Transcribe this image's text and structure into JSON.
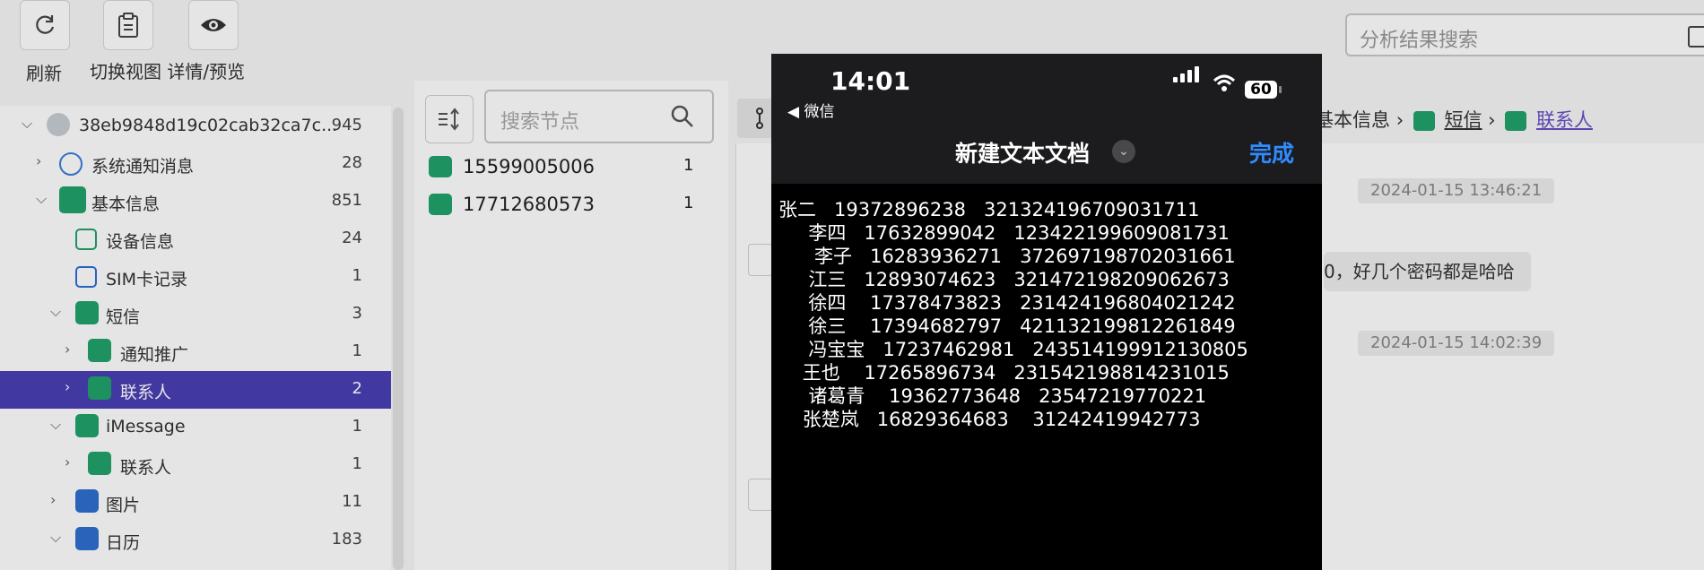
{
  "toolbar": {
    "refresh_label": "刷新",
    "switch_view_label": "切换视图 详情/预览",
    "search_placeholder": "分析结果搜索"
  },
  "tree": [
    {
      "label": "38eb9848d19c02cab32ca7c...",
      "count": "945"
    },
    {
      "label": "系统通知消息",
      "count": "28"
    },
    {
      "label": "基本信息",
      "count": "851"
    },
    {
      "label": "设备信息",
      "count": "24"
    },
    {
      "label": "SIM卡记录",
      "count": "1"
    },
    {
      "label": "短信",
      "count": "3"
    },
    {
      "label": "通知推广",
      "count": "1"
    },
    {
      "label": "联系人",
      "count": "2"
    },
    {
      "label": "iMessage",
      "count": "1"
    },
    {
      "label": "联系人",
      "count": "1"
    },
    {
      "label": "图片",
      "count": "11"
    },
    {
      "label": "日历",
      "count": "183"
    }
  ],
  "node_search": {
    "placeholder": "搜索节点"
  },
  "list": [
    {
      "label": "15599005006",
      "count": "1"
    },
    {
      "label": "17712680573",
      "count": "1"
    }
  ],
  "breadcrumb": {
    "part1": "基本信息",
    "part2": "短信",
    "part3": "联系人",
    "sep": "›"
  },
  "messages": {
    "date1": "2024-01-15 13:46:21",
    "bubble": "0，好几个密码都是哈哈",
    "date2": "2024-01-15 14:02:39"
  },
  "phone": {
    "time": "14:01",
    "back_label": "◀ 微信",
    "battery": "60",
    "title": "新建文本文档",
    "done_label": "完成",
    "lines": [
      "张二   19372896238   321324196709031711",
      "     李四   17632899042   123422199609081731",
      "      李子   16283936271   372697198702031661",
      "     江三   12893074623   321472198209062673",
      "     徐四    17378473823   231424196804021242",
      "     徐三    17394682797   421132199812261849",
      "     冯宝宝   17237462981   243514199912130805",
      "    王也    17265896734   231542198814231015",
      "     诸葛青    19362773648   23547219770221",
      "    张楚岚   16829364683    31242419942773"
    ]
  },
  "colors": {
    "selected_row": "#4a3fb5",
    "icon_green": "#21a26a",
    "done_blue": "#2f8cff"
  }
}
